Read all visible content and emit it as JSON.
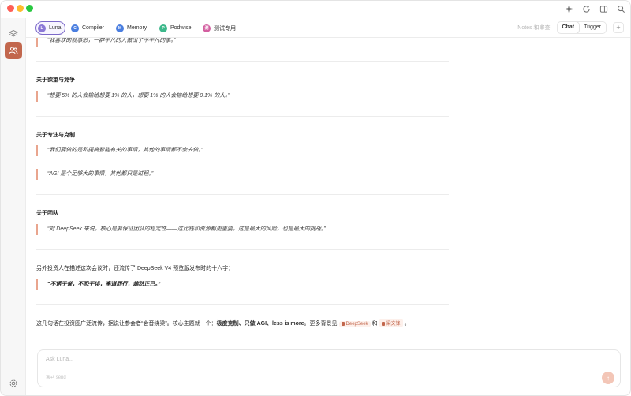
{
  "colors": {
    "accent": "#c2674d",
    "active_tab_border": "#7b68c9",
    "quote_bar": "#e9a58e"
  },
  "tabs": [
    {
      "label": "Luna",
      "initial": "L",
      "color": "#8b78d6",
      "active": true
    },
    {
      "label": "Compiler",
      "initial": "C",
      "color": "#4a7ee0",
      "active": false
    },
    {
      "label": "Memory",
      "initial": "M",
      "color": "#4a7ee0",
      "active": false
    },
    {
      "label": "Podwise",
      "initial": "P",
      "color": "#3db88b",
      "active": false
    },
    {
      "label": "测试专用",
      "initial": "测",
      "color": "#d35fa0",
      "active": false
    }
  ],
  "right_tabs": {
    "faded": "Notes 和审查",
    "chat": "Chat",
    "trigger": "Trigger",
    "add": "+"
  },
  "content": {
    "top_quote": "“我喜欢的就事形，一群平凡的人做出了不平凡的事。”",
    "sections": [
      {
        "heading": "关于欲望与竞争",
        "quotes": [
          "“想要 5% 的人会输给想要 1% 的人，想要 1% 的人会输给想要 0.1% 的人。”"
        ]
      },
      {
        "heading": "关于专注与克制",
        "quotes": [
          "“我们要做的是和提高智能有关的事情，其他的事情都不会去做。”",
          "“AGI 是个足够大的事情，其他都只是过程。”"
        ]
      },
      {
        "heading": "关于团队",
        "quotes": [
          "“对 DeepSeek 来说，核心是要保证团队的稳定性——这比钱和资源都更重要，这是最大的风险，也是最大的挑战。”"
        ]
      }
    ],
    "intro_para": "另外投资人在描述这次会议时，还流传了 DeepSeek V4 预览版发布时的十六字：",
    "bold_quote": "“不诱于誉，不恐于诽，率道而行，端然正己。”",
    "closing": {
      "text_before": "这几句话在投资圈广泛流传，据说让参会者“会音绕梁”。核心主题就一个：",
      "bold": "极度克制、只做 AGI、less is more",
      "text_middle": "。更多背景见",
      "chip1": "DeepSeek",
      "and": "和",
      "chip2": "梁文锋",
      "end": "。"
    }
  },
  "input": {
    "placeholder": "Ask Luna...",
    "hint": "⌘↵ send",
    "send_icon": "↑"
  }
}
